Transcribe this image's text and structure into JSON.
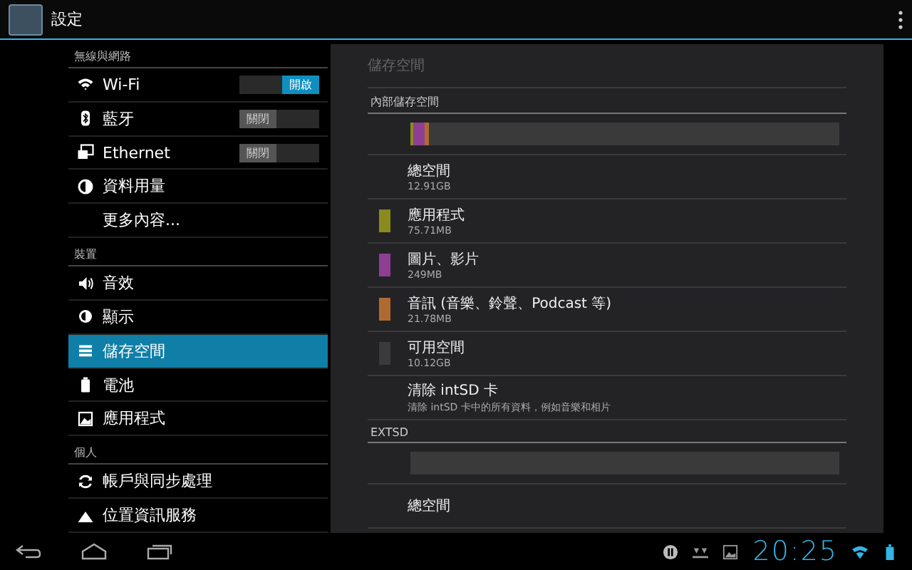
{
  "action_bar": {
    "title": "設定"
  },
  "sidebar": {
    "sections": [
      {
        "header": "無線與網路",
        "items": [
          {
            "label": "Wi-Fi",
            "selected": false,
            "toggle": {
              "label": "開啟",
              "on": true
            }
          },
          {
            "label": "藍牙",
            "selected": false,
            "toggle": {
              "label": "關閉",
              "on": false
            }
          },
          {
            "label": "Ethernet",
            "selected": false,
            "toggle": {
              "label": "關閉",
              "on": false
            }
          },
          {
            "label": "資料用量",
            "selected": false
          },
          {
            "label": "更多內容...",
            "selected": false
          }
        ]
      },
      {
        "header": "裝置",
        "items": [
          {
            "label": "音效",
            "selected": false
          },
          {
            "label": "顯示",
            "selected": false
          },
          {
            "label": "儲存空間",
            "selected": true
          },
          {
            "label": "電池",
            "selected": false
          },
          {
            "label": "應用程式",
            "selected": false
          }
        ]
      },
      {
        "header": "個人",
        "items": [
          {
            "label": "帳戶與同步處理",
            "selected": false
          },
          {
            "label": "位置資訊服務",
            "selected": false
          }
        ]
      }
    ]
  },
  "panel": {
    "title": "儲存空間",
    "groups": [
      {
        "header": "內部儲存空間",
        "usage": [
          {
            "color": "#8a8a1e",
            "level": 0.008
          },
          {
            "color": "#8e3f93",
            "level": 0.026
          },
          {
            "color": "#b06a30",
            "level": 0.008
          }
        ],
        "items": [
          {
            "label": "總空間",
            "detail": "12.91GB"
          },
          {
            "label": "應用程式",
            "detail": "75.71MB",
            "color": "#8a8a1e"
          },
          {
            "label": "圖片、影片",
            "detail": "249MB",
            "color": "#8e3f93"
          },
          {
            "label": "音訊 (音樂、鈴聲、Podcast 等)",
            "detail": "21.78MB",
            "color": "#b06a30"
          },
          {
            "label": "可用空間",
            "detail": "10.12GB",
            "color": "#3a3a3a"
          },
          {
            "label": "清除 intSD 卡",
            "detail": "清除 intSD 卡中的所有資料，例如音樂和相片"
          }
        ]
      },
      {
        "header": "EXTSD",
        "items": [
          {
            "label": "總空間"
          }
        ]
      }
    ]
  },
  "status_bar": {
    "clock": "20:25"
  }
}
